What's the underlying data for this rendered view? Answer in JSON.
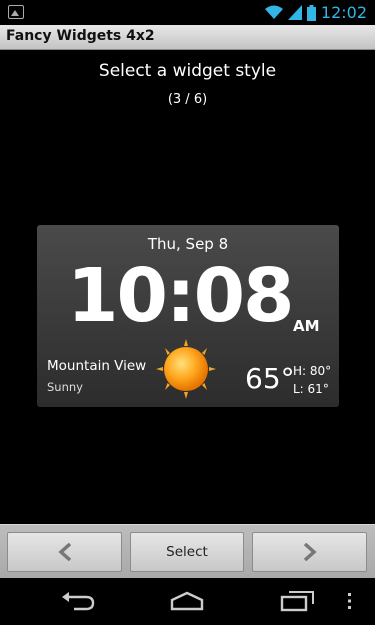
{
  "status_bar": {
    "time": "12:02",
    "icons": [
      "image-notification-icon",
      "wifi-icon",
      "signal-icon",
      "battery-icon"
    ],
    "accent_color": "#33b5e5"
  },
  "app": {
    "title": "Fancy Widgets 4x2"
  },
  "main": {
    "heading": "Select a widget style",
    "counter": "(3 / 6)"
  },
  "widget": {
    "date": "Thu, Sep 8",
    "time": "10:08",
    "ampm": "AM",
    "location": "Mountain View",
    "condition": "Sunny",
    "condition_icon": "sun-icon",
    "temperature": "65°",
    "high": "H:  80°",
    "low": "L:  61°"
  },
  "buttons": {
    "prev_icon": "chevron-left-icon",
    "select_label": "Select",
    "next_icon": "chevron-right-icon"
  },
  "nav": {
    "icons": [
      "back-icon",
      "home-icon",
      "recent-apps-icon",
      "menu-icon"
    ]
  }
}
